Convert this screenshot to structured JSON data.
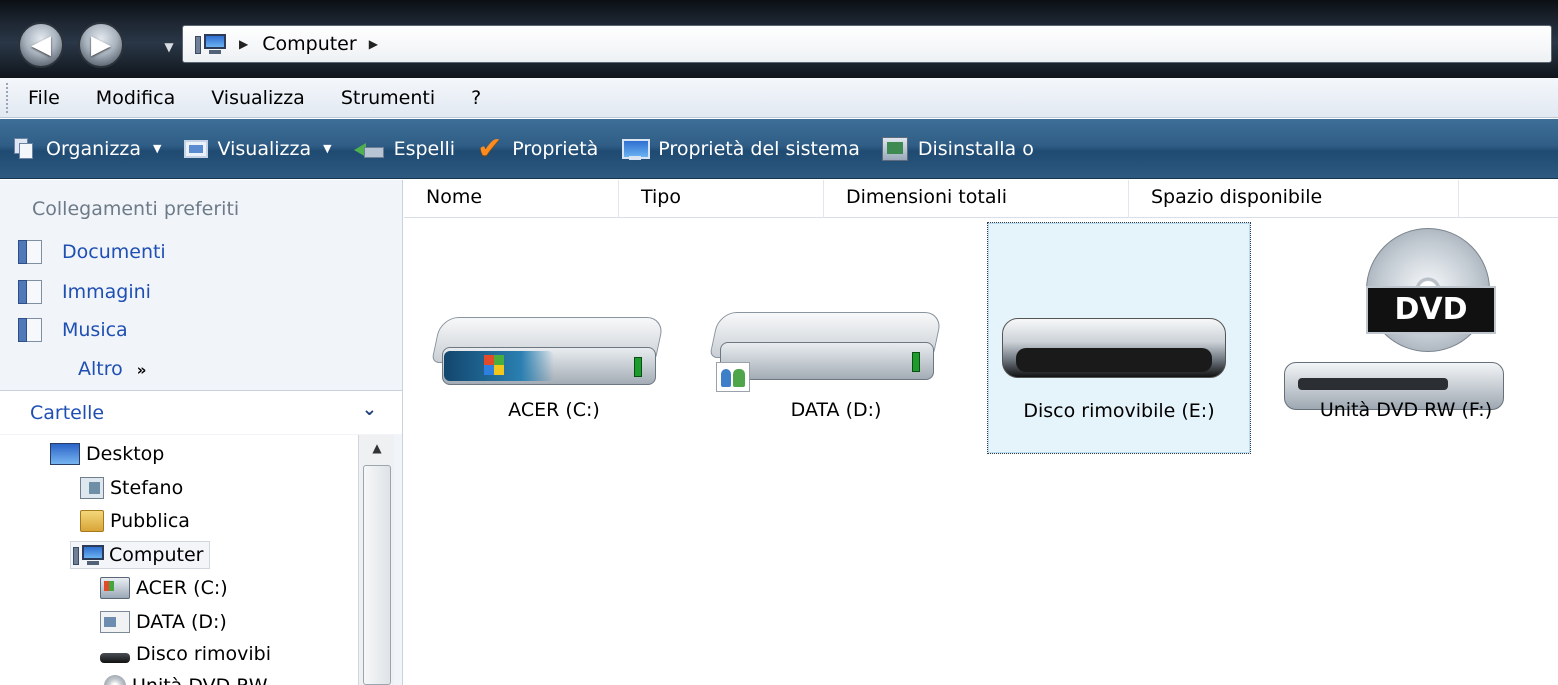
{
  "window": {
    "nav": {
      "back_glyph": "◀",
      "forward_glyph": "▶",
      "history_glyph": "▼"
    },
    "address": {
      "crumbs": [
        "Computer"
      ],
      "separator": "▶"
    }
  },
  "menu": {
    "items": [
      "File",
      "Modifica",
      "Visualizza",
      "Strumenti",
      "?"
    ]
  },
  "toolbar": {
    "items": [
      {
        "label": "Organizza",
        "icon": "organize-icon",
        "dropdown": true
      },
      {
        "label": "Visualizza",
        "icon": "views-icon",
        "dropdown": true
      },
      {
        "label": "Espelli",
        "icon": "eject-icon"
      },
      {
        "label": "Proprietà",
        "icon": "checkmark-icon"
      },
      {
        "label": "Proprietà del sistema",
        "icon": "system-properties-icon"
      },
      {
        "label": "Disinstalla o",
        "icon": "uninstall-icon"
      }
    ],
    "caret_glyph": "▼"
  },
  "nav_pane": {
    "favorites_header": "Collegamenti preferiti",
    "favorites": [
      {
        "label": "Documenti",
        "icon": "documents-icon"
      },
      {
        "label": "Immagini",
        "icon": "pictures-icon"
      },
      {
        "label": "Musica",
        "icon": "music-icon"
      }
    ],
    "more_label": "Altro",
    "more_glyph": "»",
    "folders_header": "Cartelle",
    "folders_toggle_glyph": "⌄",
    "tree": [
      {
        "label": "Desktop",
        "icon": "desktop-icon"
      },
      {
        "label": "Stefano",
        "icon": "user-folder-icon"
      },
      {
        "label": "Pubblica",
        "icon": "folder-icon"
      },
      {
        "label": "Computer",
        "icon": "computer-icon",
        "selected": true
      },
      {
        "label": "ACER (C:)",
        "icon": "system-drive-icon"
      },
      {
        "label": "DATA (D:)",
        "icon": "shared-drive-icon"
      },
      {
        "label": "Disco rimovibi",
        "icon": "removable-drive-icon"
      },
      {
        "label": "Unità DVD RW",
        "icon": "dvd-drive-icon"
      }
    ],
    "scroll_up_glyph": "▲"
  },
  "content": {
    "columns": [
      "Nome",
      "Tipo",
      "Dimensioni totali",
      "Spazio disponibile"
    ],
    "drives": [
      {
        "label": "ACER (C:)",
        "icon": "windows-hard-drive-icon"
      },
      {
        "label": "DATA (D:)",
        "icon": "shared-hard-drive-icon"
      },
      {
        "label": "Disco rimovibile (E:)",
        "icon": "removable-disk-icon",
        "selected": true
      },
      {
        "label": "Unità DVD RW (F:)",
        "icon": "dvd-rw-drive-icon",
        "badge": "DVD"
      }
    ]
  },
  "colors": {
    "toolbar_bg": "#2f5d86",
    "link_blue": "#1f4fb3",
    "selection_bg": "#e5f3fb",
    "nav_pane_bg": "#f1f5fa"
  }
}
